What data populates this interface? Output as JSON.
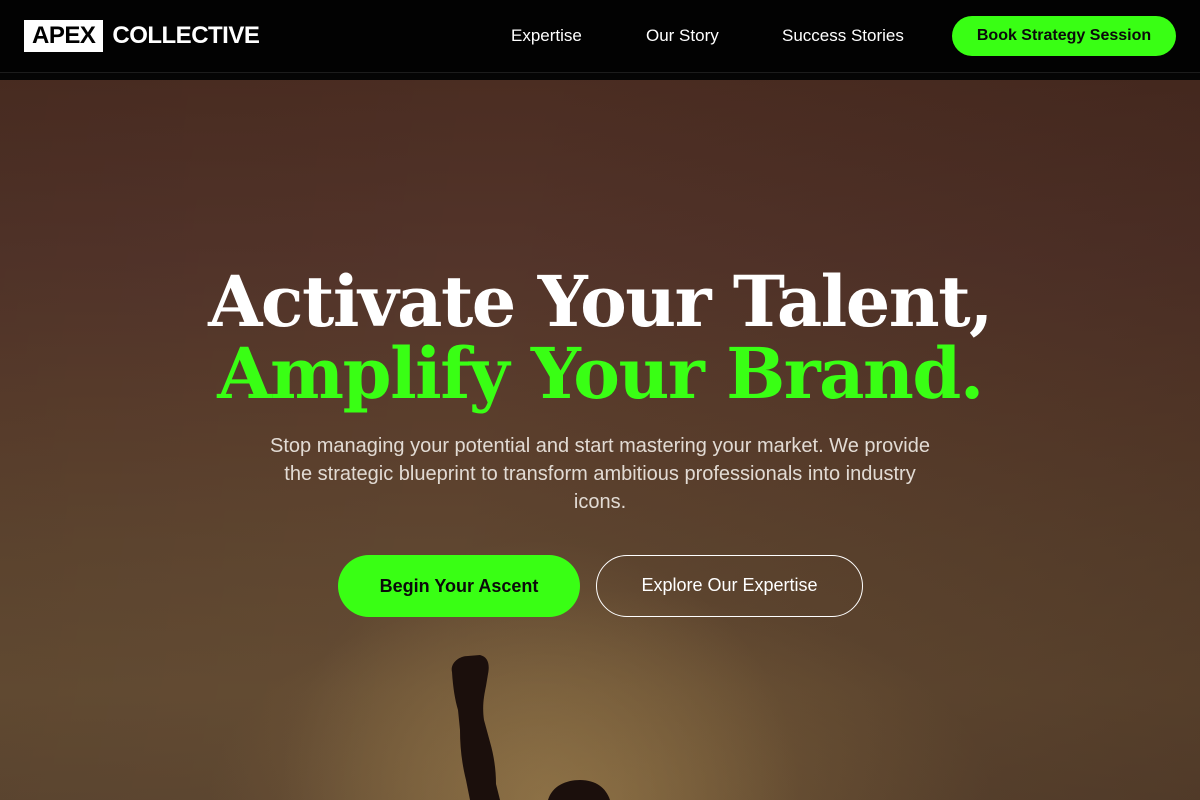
{
  "brand": {
    "logo_box": "APEX",
    "logo_rest": "COLLECTIVE"
  },
  "nav": {
    "links": [
      "Expertise",
      "Our Story",
      "Success Stories"
    ],
    "cta": "Book Strategy Session"
  },
  "hero": {
    "headline_line1": "Activate Your Talent,",
    "headline_line2": "Amplify Your Brand.",
    "subtext": "Stop managing your potential and start mastering your market. We provide the strategic blueprint to transform ambitious professionals into industry icons.",
    "primary_button": "Begin Your Ascent",
    "secondary_button": "Explore Our Expertise"
  },
  "colors": {
    "accent": "#39ff14",
    "navbar_bg": "#020202",
    "hero_bg": "#5a3d2c",
    "text_light": "#ffffff"
  }
}
